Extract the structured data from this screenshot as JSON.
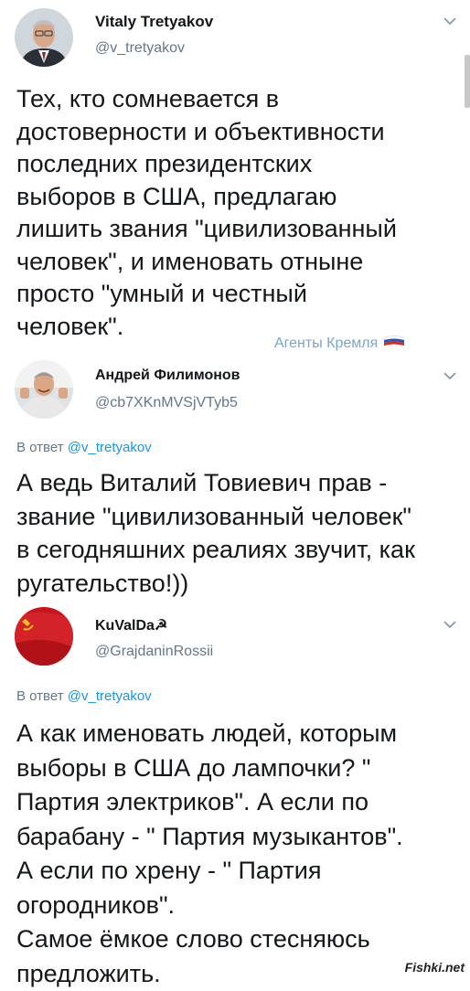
{
  "tweets": [
    {
      "name": "Vitaly Tretyakov",
      "handle": "@v_tretyakov",
      "reply_prefix": "",
      "reply_to": "",
      "text": "Тех, кто сомневается в\nдостоверности и объективности\nпоследних президентских\nвыборов в США, предлагаю\nлишить звания \"цивилизованный\nчеловек\", и именовать отныне\nпросто \"умный и честный\nчеловек\"."
    },
    {
      "name": "Андрей Филимонов",
      "handle": "@cb7XKnMVSjVTyb5",
      "reply_prefix": "В ответ ",
      "reply_to": "@v_tretyakov",
      "text": "А ведь Виталий Товиевич прав -\nзвание \"цивилизованный человек\"\nв сегодняшних реалиях звучит, как\nругательство!))"
    },
    {
      "name": "KuValDa☭",
      "handle": "@GrajdaninRossii",
      "reply_prefix": "В ответ ",
      "reply_to": "@v_tretyakov",
      "text": "А как именовать людей, которым\nвыборы в США до лампочки? \"\nПартия электриков\". А если по\nбарабану - \" Партия музыкантов\".\nА если по хрену - \" Партия\nогородников\".\nСамое ёмкое слово стесняюсь\nпредложить."
    }
  ],
  "badge": {
    "label": "Агенты Кремля",
    "icon": "russian-flag-icon"
  },
  "watermark": "Fishki.net",
  "colors": {
    "link": "#1b95e0",
    "muted": "#657786",
    "text": "#14171a"
  }
}
